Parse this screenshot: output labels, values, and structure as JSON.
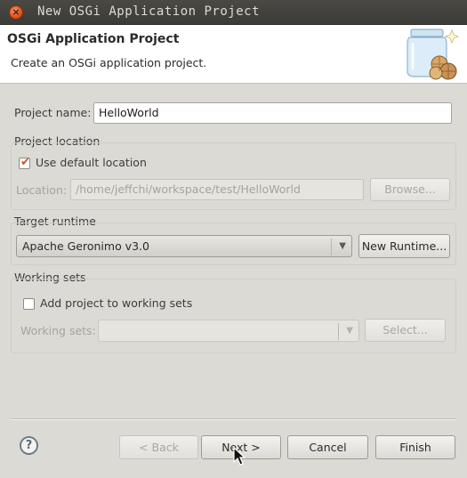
{
  "window": {
    "title": "New OSGi Application Project"
  },
  "header": {
    "title": "OSGi Application Project",
    "description": "Create an OSGi application project.",
    "icon": "jar-with-bundles-icon"
  },
  "project_name": {
    "label": "Project name:",
    "value": "HelloWorld"
  },
  "project_location": {
    "group_label": "Project location",
    "use_default_label": "Use default location",
    "use_default_checked": true,
    "location_label": "Location:",
    "location_value": "/home/jeffchi/workspace/test/HelloWorld",
    "browse_label": "Browse..."
  },
  "target_runtime": {
    "group_label": "Target runtime",
    "selected": "Apache Geronimo v3.0",
    "new_runtime_label": "New Runtime..."
  },
  "working_sets": {
    "group_label": "Working sets",
    "add_label": "Add project to working sets",
    "add_checked": false,
    "sets_label": "Working sets:",
    "sets_value": "",
    "select_label": "Select..."
  },
  "footer": {
    "back_label": "< Back",
    "next_label": "Next >",
    "cancel_label": "Cancel",
    "finish_label": "Finish",
    "help_glyph": "?"
  }
}
